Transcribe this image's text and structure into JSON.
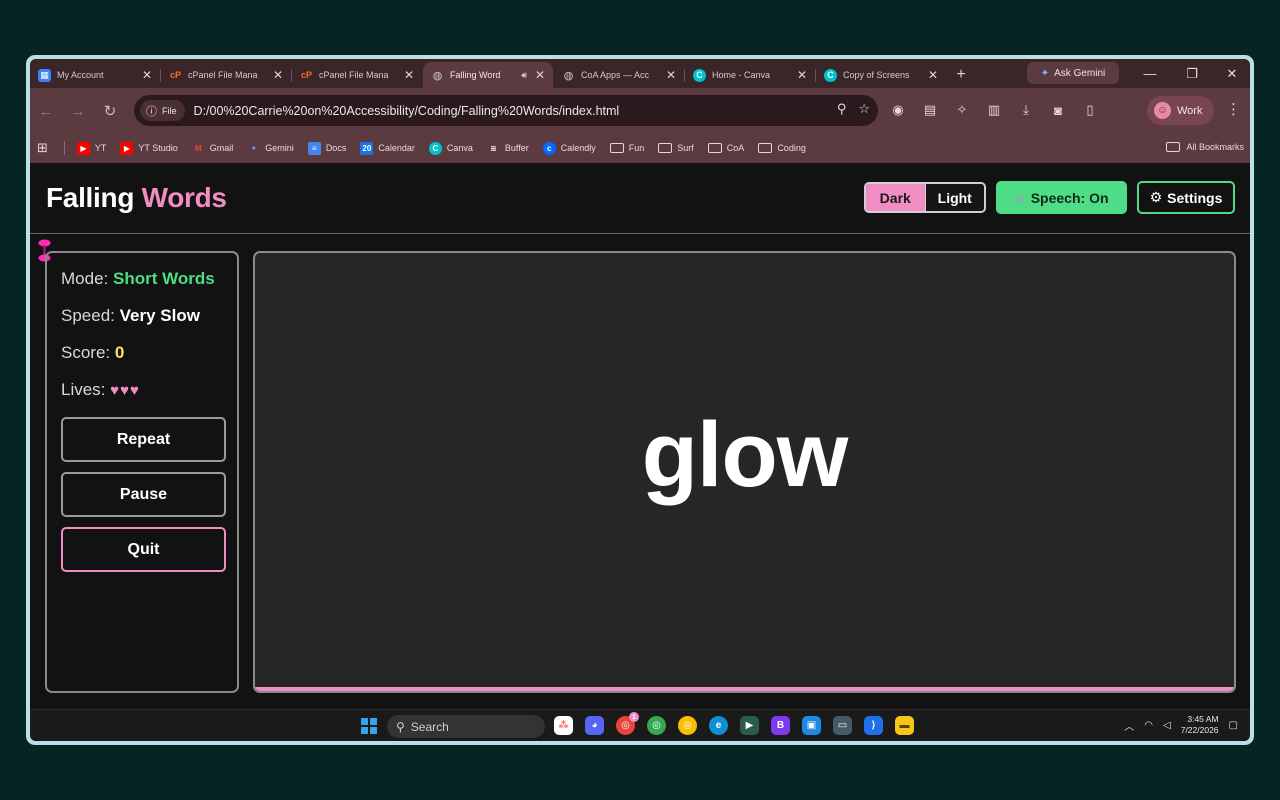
{
  "browser": {
    "tabs": [
      {
        "title": "My Account",
        "icon": "grid-icon",
        "color": "#3b82f6"
      },
      {
        "title": "cPanel File Mana",
        "icon": "cpanel-icon",
        "color": "#ff6c2c"
      },
      {
        "title": "cPanel File Mana",
        "icon": "cpanel-icon",
        "color": "#ff6c2c"
      },
      {
        "title": "Falling Word",
        "icon": "globe-icon",
        "color": "#9aa0a6",
        "active": true
      },
      {
        "title": "CoA Apps — Acc",
        "icon": "globe-icon",
        "color": "#9aa0a6"
      },
      {
        "title": "Home - Canva",
        "icon": "canva-icon",
        "color": "#00c4cc"
      },
      {
        "title": "Copy of Screens",
        "icon": "canva-icon",
        "color": "#00c4cc"
      }
    ],
    "ask_gemini": "Ask Gemini",
    "file_chip": "File",
    "url": "D:/00%20Carrie%20on%20Accessibility/Coding/Falling%20Words/index.html",
    "profile_label": "Work",
    "bookmarks": [
      {
        "label": "YT",
        "icon": "youtube-icon",
        "color": "#ff0000"
      },
      {
        "label": "YT Studio",
        "icon": "youtube-icon",
        "color": "#ff0000"
      },
      {
        "label": "Gmail",
        "icon": "gmail-icon",
        "color": "#ea4335"
      },
      {
        "label": "Gemini",
        "icon": "gemini-icon",
        "color": "#6a8ff5"
      },
      {
        "label": "Docs",
        "icon": "docs-icon",
        "color": "#4285f4"
      },
      {
        "label": "Calendar",
        "icon": "calendar-icon",
        "color": "#1a73e8"
      },
      {
        "label": "Canva",
        "icon": "canva-icon",
        "color": "#00c4cc"
      },
      {
        "label": "Buffer",
        "icon": "buffer-icon",
        "color": "#ffffff"
      },
      {
        "label": "Calendly",
        "icon": "calendly-icon",
        "color": "#006bff"
      },
      {
        "label": "Fun",
        "icon": "folder-icon"
      },
      {
        "label": "Surf",
        "icon": "folder-icon"
      },
      {
        "label": "CoA",
        "icon": "folder-icon"
      },
      {
        "label": "Coding",
        "icon": "folder-icon"
      }
    ],
    "all_bookmarks": "All Bookmarks"
  },
  "app": {
    "logo_main": "Falling",
    "logo_accent": "Words",
    "theme": {
      "dark": "Dark",
      "light": "Light",
      "selected": "Dark"
    },
    "speech_button": "Speech: On",
    "settings_button": "Settings",
    "stats": {
      "mode_label": "Mode:",
      "mode_value": "Short Words",
      "speed_label": "Speed:",
      "speed_value": "Very Slow",
      "score_label": "Score:",
      "score_value": "0",
      "lives_label": "Lives:",
      "lives_value": "♥♥♥"
    },
    "buttons": {
      "repeat": "Repeat",
      "pause": "Pause",
      "quit": "Quit"
    },
    "current_word": "glow",
    "colors": {
      "accent_pink": "#f28dc3",
      "accent_green": "#4fdc86",
      "score_yellow": "#ffe066"
    }
  },
  "taskbar": {
    "search_placeholder": "Search",
    "time": "3:45 AM",
    "date": "7/22/2026",
    "badge_count": "1"
  }
}
